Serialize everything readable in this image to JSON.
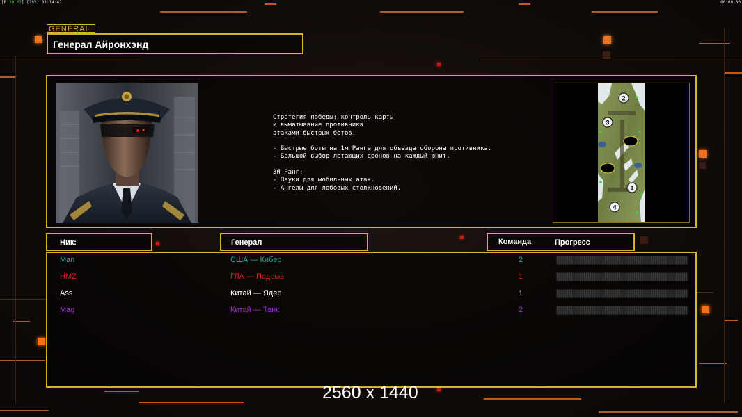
{
  "status_bar": {
    "left_prefix": "[R:",
    "left_green": "30 32",
    "left_mid": "] [",
    "left_dim": "165",
    "left_suffix": "] 01:14:42",
    "right": "00:00:00"
  },
  "general": {
    "tag": "GENERAL",
    "name": "Генерал Айронхэнд",
    "description": "Стратегия победы: контроль карты\nи выматывание противника\nатаками быстрых ботов.\n\n- Быстрые боты на 1м Ранге для объезда обороны противника.\n- Большой выбор летающих дронов на каждый юнит.\n\n3й Ранг:\n- Пауки для мобильных атак.\n- Ангелы для лобовых столкновений."
  },
  "map": {
    "spawn_labels": [
      "2",
      "3",
      "1",
      "4"
    ]
  },
  "columns": {
    "nick": "Ник:",
    "general": "Генерал",
    "team": "Команда",
    "progress": "Прогресс"
  },
  "players": [
    {
      "nick": "Man",
      "general": "США — Кибер",
      "team": "2",
      "color": "#2aa7a0",
      "progress": 0
    },
    {
      "nick": "HMZ",
      "general": "ГЛА — Подрыв",
      "team": "1",
      "color": "#e01f1f",
      "progress": 0
    },
    {
      "nick": "Ass",
      "general": "Китай — Ядер",
      "team": "1",
      "color": "#ffffff",
      "progress": 0
    },
    {
      "nick": "Mag",
      "general": "Китай — Танк",
      "team": "2",
      "color": "#a42ad6",
      "progress": 0
    }
  ],
  "resolution_label": "2560 x 1440",
  "colors": {
    "frame": "#d9b12b",
    "accent": "#f0701c"
  }
}
